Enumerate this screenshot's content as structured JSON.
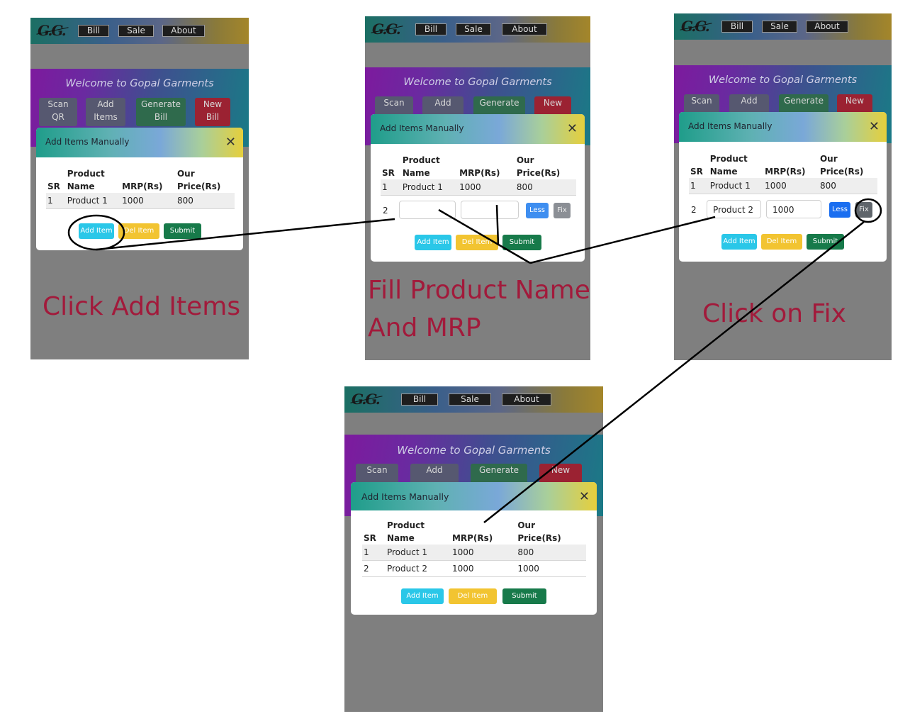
{
  "nav": {
    "bill": "Bill",
    "sale": "Sale",
    "about": "About"
  },
  "logo_text": "G.G.",
  "welcome_title": "Welcome to Gopal Garments",
  "actions": {
    "scan_line1": "Scan",
    "scan_line2": "QR",
    "add_line1": "Add",
    "add_line2": "Items",
    "generate_line1": "Generate",
    "generate_line2": "Bill",
    "new_line1": "New",
    "new_line2": "Bill"
  },
  "modal": {
    "title": "Add Items Manually",
    "close": "✕",
    "headers": {
      "sr": "SR",
      "product_top": "Product",
      "product_bottom": "Name",
      "mrp": "MRP(Rs)",
      "our_top": "Our",
      "our_bottom": "Price(Rs)"
    },
    "rows": [
      {
        "sr": "1",
        "name": "Product 1",
        "mrp": "1000",
        "price": "800"
      },
      {
        "sr": "2",
        "name": "Product 2",
        "mrp": "1000",
        "price": "1000"
      }
    ],
    "buttons": {
      "add": "Add Item",
      "del": "Del Item",
      "submit": "Submit",
      "less": "Less",
      "fix": "Fix"
    }
  },
  "captions": {
    "step1": "Click Add Items",
    "step2_line1": "Fill Product Name",
    "step2_line2": "And MRP",
    "step3": "Click on Fix"
  },
  "colors": {
    "caption": "#a21a3b",
    "add_btn": "#2ac7e8",
    "del_btn": "#f2c431",
    "submit_btn": "#177a4a",
    "less_btn": "#3e8ef0"
  }
}
